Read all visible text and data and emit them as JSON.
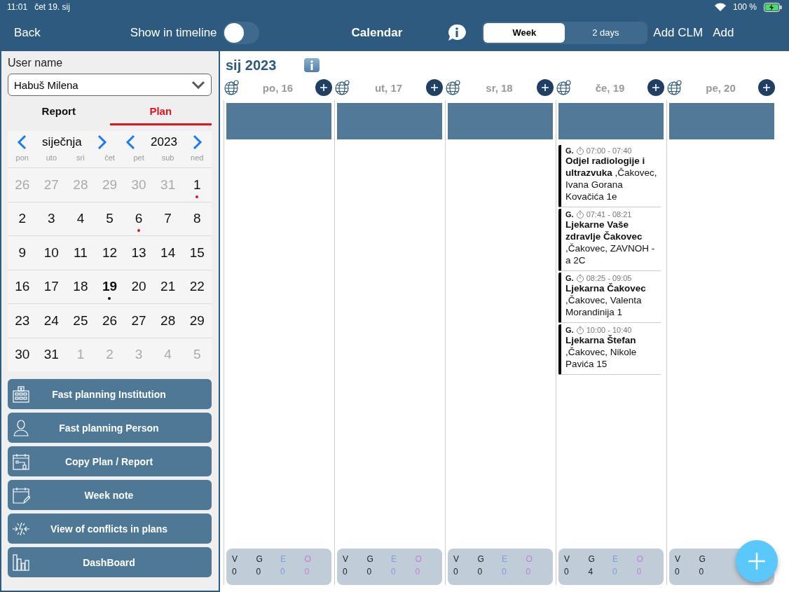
{
  "status_bar": {
    "time": "11:01",
    "date": "čet 19. sij",
    "battery": "100 %"
  },
  "nav": {
    "back": "Back",
    "timeline_label": "Show in timeline",
    "timeline_on": false,
    "title": "Calendar",
    "segments": [
      {
        "label": "Week",
        "selected": true
      },
      {
        "label": "2 days",
        "selected": false
      }
    ],
    "actions": [
      "Add CLM",
      "Add"
    ]
  },
  "sidebar": {
    "user_label": "User name",
    "user_value": "Habuš Milena",
    "tabs": [
      {
        "label": "Report",
        "selected": false
      },
      {
        "label": "Plan",
        "selected": true
      }
    ],
    "month": "siječnja",
    "year": "2023",
    "weekdays": [
      "pon",
      "uto",
      "sri",
      "čet",
      "pet",
      "sub",
      "ned"
    ],
    "weeks": [
      {
        "days": [
          {
            "label": "26",
            "muted": true,
            "today": false
          },
          {
            "label": "27",
            "muted": true,
            "today": false
          },
          {
            "label": "28",
            "muted": true,
            "today": false
          },
          {
            "label": "29",
            "muted": true,
            "today": false
          },
          {
            "label": "30",
            "muted": true,
            "today": false
          },
          {
            "label": "31",
            "muted": true,
            "today": false
          },
          {
            "label": "1",
            "muted": false,
            "today": false,
            "color": "#e0141e"
          }
        ]
      },
      {
        "days": [
          {
            "label": "2",
            "muted": false,
            "today": false
          },
          {
            "label": "3",
            "muted": false,
            "today": false
          },
          {
            "label": "4",
            "muted": false,
            "today": false
          },
          {
            "label": "5",
            "muted": false,
            "today": false
          },
          {
            "label": "6",
            "muted": false,
            "today": false,
            "color": "#e0141e"
          },
          {
            "label": "7",
            "muted": false,
            "today": false
          },
          {
            "label": "8",
            "muted": false,
            "today": false
          }
        ]
      },
      {
        "days": [
          {
            "label": "9",
            "muted": false,
            "today": false
          },
          {
            "label": "10",
            "muted": false,
            "today": false
          },
          {
            "label": "11",
            "muted": false,
            "today": false
          },
          {
            "label": "12",
            "muted": false,
            "today": false
          },
          {
            "label": "13",
            "muted": false,
            "today": false
          },
          {
            "label": "14",
            "muted": false,
            "today": false
          },
          {
            "label": "15",
            "muted": false,
            "today": false
          }
        ]
      },
      {
        "days": [
          {
            "label": "16",
            "muted": false,
            "today": false
          },
          {
            "label": "17",
            "muted": false,
            "today": false
          },
          {
            "label": "18",
            "muted": false,
            "today": false
          },
          {
            "label": "19",
            "muted": false,
            "today": true,
            "color": "#111111"
          },
          {
            "label": "20",
            "muted": false,
            "today": false
          },
          {
            "label": "21",
            "muted": false,
            "today": false
          },
          {
            "label": "22",
            "muted": false,
            "today": false
          }
        ]
      },
      {
        "days": [
          {
            "label": "23",
            "muted": false,
            "today": false
          },
          {
            "label": "24",
            "muted": false,
            "today": false
          },
          {
            "label": "25",
            "muted": false,
            "today": false
          },
          {
            "label": "26",
            "muted": false,
            "today": false
          },
          {
            "label": "27",
            "muted": false,
            "today": false
          },
          {
            "label": "28",
            "muted": false,
            "today": false
          },
          {
            "label": "29",
            "muted": false,
            "today": false
          }
        ]
      },
      {
        "days": [
          {
            "label": "30",
            "muted": false,
            "today": false
          },
          {
            "label": "31",
            "muted": false,
            "today": false
          },
          {
            "label": "1",
            "muted": true,
            "today": false
          },
          {
            "label": "2",
            "muted": true,
            "today": false
          },
          {
            "label": "3",
            "muted": true,
            "today": false
          },
          {
            "label": "4",
            "muted": true,
            "today": false
          },
          {
            "label": "5",
            "muted": true,
            "today": false
          }
        ]
      }
    ],
    "buttons": [
      {
        "label": "Fast planning Institution",
        "kind": "institution"
      },
      {
        "label": "Fast planning Person",
        "kind": "person"
      },
      {
        "label": "Copy Plan / Report",
        "kind": "copy"
      },
      {
        "label": "Week note",
        "kind": "note"
      },
      {
        "label": "View of conflicts in plans",
        "kind": "conflicts"
      },
      {
        "label": "DashBoard",
        "kind": "dashboard"
      }
    ]
  },
  "week": {
    "title": "sij 2023",
    "days": [
      {
        "label": "po, 16",
        "summary": [
          {
            "label": "V",
            "value": "0"
          },
          {
            "label": "G",
            "value": "0"
          },
          {
            "label": "E",
            "value": "0",
            "color": "#7a9fe0"
          },
          {
            "label": "O",
            "value": "0",
            "color": "#c77ae0"
          }
        ]
      },
      {
        "label": "ut, 17",
        "summary": [
          {
            "label": "V",
            "value": "0"
          },
          {
            "label": "G",
            "value": "0"
          },
          {
            "label": "E",
            "value": "0",
            "color": "#7a9fe0"
          },
          {
            "label": "O",
            "value": "0",
            "color": "#c77ae0"
          }
        ]
      },
      {
        "label": "sr, 18",
        "summary": [
          {
            "label": "V",
            "value": "0"
          },
          {
            "label": "G",
            "value": "0"
          },
          {
            "label": "E",
            "value": "0",
            "color": "#7a9fe0"
          },
          {
            "label": "O",
            "value": "0",
            "color": "#c77ae0"
          }
        ]
      },
      {
        "label": "če, 19",
        "events": [
          {
            "type": "G.",
            "time": "07:00 - 07:40",
            "text": "**Odjel radiologije i ultrazvuka** ,Čakovec, Ivana Gorana Kovačića 1e"
          },
          {
            "type": "G.",
            "time": "07:41 - 08:21",
            "text": "**Ljekarne Vaše zdravlje Čakovec** ,Čakovec, ZAVNOH - a 2C"
          },
          {
            "type": "G.",
            "time": "08:25 - 09:05",
            "text": "**Ljekarna Čakovec** ,Čakovec, Valenta Morandinija 1"
          },
          {
            "type": "G.",
            "time": "10:00 - 10:40",
            "text": "**Ljekarna Štefan** ,Čakovec, Nikole Pavića 15"
          }
        ],
        "summary": [
          {
            "label": "V",
            "value": "0"
          },
          {
            "label": "G",
            "value": "4"
          },
          {
            "label": "E",
            "value": "0",
            "color": "#7a9fe0"
          },
          {
            "label": "O",
            "value": "0",
            "color": "#c77ae0"
          }
        ]
      },
      {
        "label": "pe, 20",
        "summary": [
          {
            "label": "V",
            "value": "0"
          },
          {
            "label": "G",
            "value": "0"
          }
        ]
      }
    ]
  }
}
